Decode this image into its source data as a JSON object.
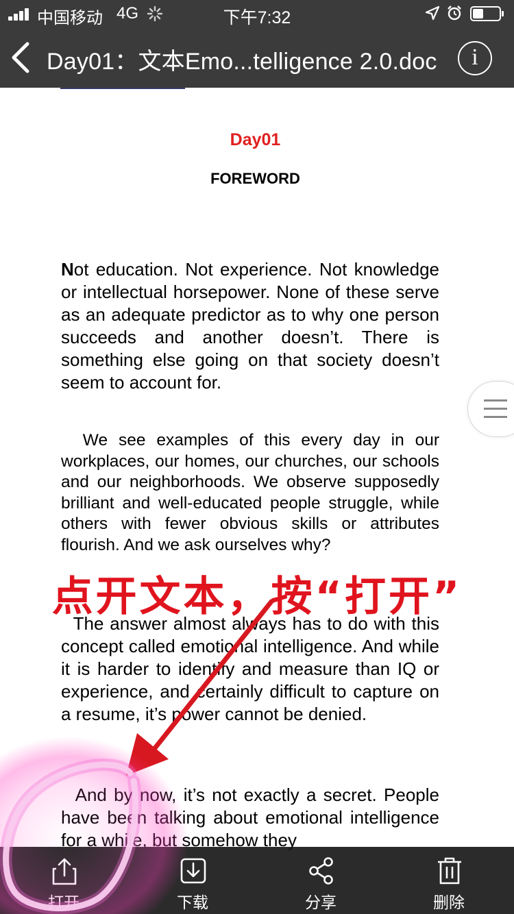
{
  "status_bar": {
    "carrier": "中国移动",
    "network": "4G",
    "time": "下午7:32"
  },
  "nav": {
    "title": "Day01：文本Emo...telligence 2.0.doc",
    "info_label": "i"
  },
  "document": {
    "day": "Day01",
    "heading": "FOREWORD",
    "paragraphs": [
      {
        "first": "N",
        "rest": "ot education. Not experience. Not knowledge or intellectual horsepower. None of these serve as an adequate predictor as to why one person succeeds and another doesn’t. There is something else going on that society doesn’t seem to account for."
      },
      {
        "text": "We see examples of this every day in our workplaces, our homes, our churches, our schools and our neighborhoods. We observe supposedly brilliant and well-educated people struggle, while others with fewer obvious skills or attributes flourish. And we ask ourselves why?"
      },
      {
        "text": "The answer almost always has to do with this concept called emotional intelligence. And while it is harder to identify and measure than IQ or experience, and certainly difficult to capture on a resume, it’s power cannot be denied."
      },
      {
        "text": "And by now, it’s not exactly a secret. People have been talking about emotional intelligence for a while, but somehow they"
      }
    ]
  },
  "annotation": {
    "text": "点开文本，按“打开”",
    "color": "#e0141e"
  },
  "toolbar": {
    "open": "打开",
    "download": "下载",
    "share": "分享",
    "delete": "删除"
  },
  "colors": {
    "bar": "#3b3b3b",
    "accent_red": "#e02020",
    "highlight": "#e02aa0"
  }
}
